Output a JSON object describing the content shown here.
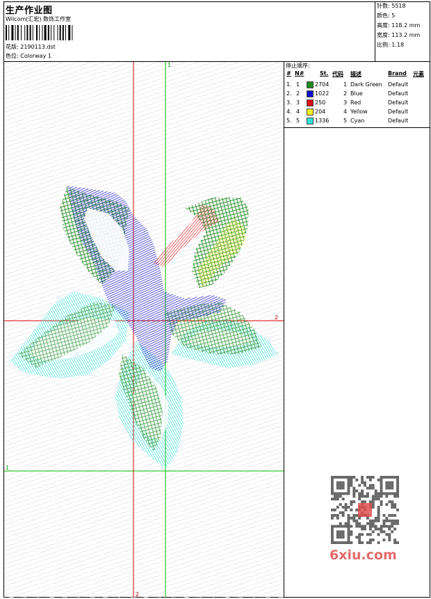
{
  "header": {
    "title": "生产作业图",
    "studio": "Wilcom(汇宏) 数饰工作室",
    "design_label": "花版: 2190113.dst",
    "colorway_label": "色位: Colorway 1"
  },
  "stats": [
    {
      "label": "针数:",
      "value": "5518"
    },
    {
      "label": "颜色:",
      "value": "5"
    },
    {
      "label": "高度:",
      "value": "118.2 mm"
    },
    {
      "label": "宽度:",
      "value": "113.2 mm"
    },
    {
      "label": "比例:",
      "value": "1.18"
    }
  ],
  "stop_sequence": {
    "title": "停止顺序:",
    "columns": [
      "#",
      "N#",
      "St.",
      "代码",
      "描述",
      "Brand",
      "元素"
    ],
    "rows": [
      {
        "num": "1.",
        "n": "1",
        "stitches": "2704",
        "code": "1",
        "desc": "Dark Green",
        "brand": "Default",
        "color": "#1e8c1e"
      },
      {
        "num": "2.",
        "n": "2",
        "stitches": "1022",
        "code": "2",
        "desc": "Blue",
        "brand": "Default",
        "color": "#1010c8"
      },
      {
        "num": "3.",
        "n": "3",
        "stitches": "250",
        "code": "3",
        "desc": "Red",
        "brand": "Default",
        "color": "#d81010"
      },
      {
        "num": "4.",
        "n": "4",
        "stitches": "204",
        "code": "4",
        "desc": "Yellow",
        "brand": "Default",
        "color": "#f0f020"
      },
      {
        "num": "5.",
        "n": "5",
        "stitches": "1336",
        "code": "5",
        "desc": "Cyan",
        "brand": "Default",
        "color": "#30e0d8"
      }
    ]
  },
  "axis_labels": {
    "green_vertical": "1",
    "green_horizontal": "1",
    "red_horizontal": "2",
    "red_vertical": "2"
  },
  "watermark": "6xiu.com",
  "colors": {
    "green_guide": "#00c000",
    "red_guide": "#e00000",
    "dark_green": "#1e8c1e",
    "blue": "#1010c8",
    "red": "#d81010",
    "yellow": "#f0f020",
    "cyan": "#30e0d8",
    "watermark": "#e05050"
  }
}
